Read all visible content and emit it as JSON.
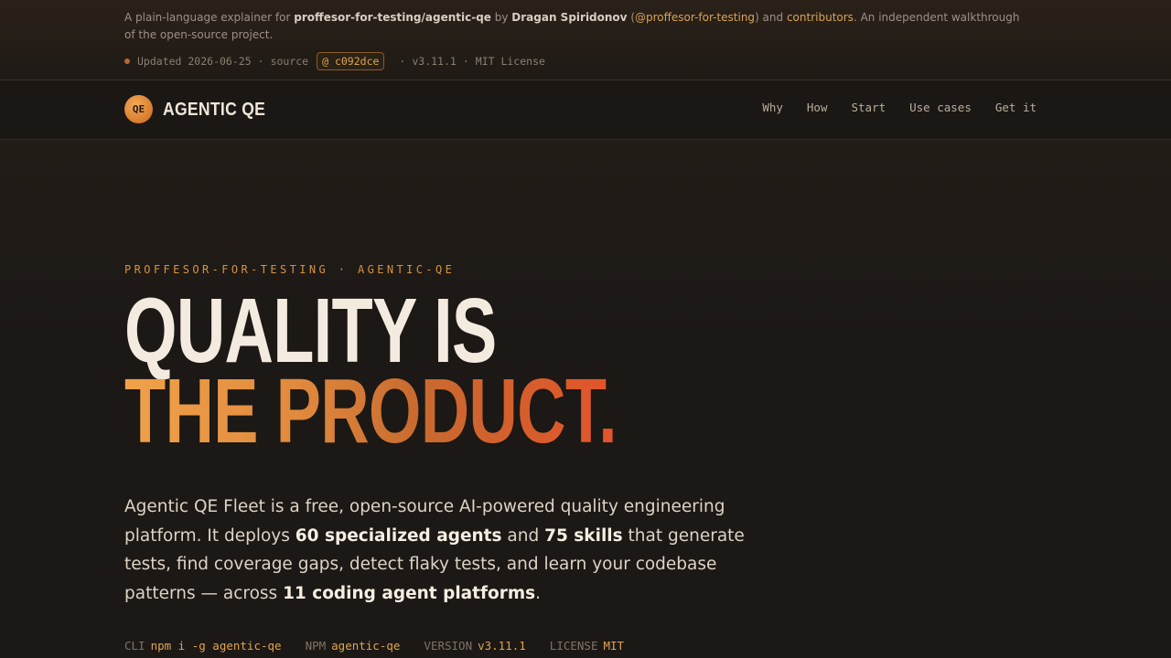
{
  "intro": {
    "prefix": "A plain-language explainer for ",
    "repo": "proffesor-for-testing/agentic-qe",
    "by": " by ",
    "author": "Dragan Spiridonov",
    "paren_open": " (",
    "handle": "@proffesor-for-testing",
    "paren_close": ") and ",
    "contributors": "contributors",
    "suffix": ". An independent walkthrough of the open-source project."
  },
  "meta": {
    "updated": "Updated 2026-06-25",
    "sep1": "·",
    "source_label": "source",
    "sha": "@ c092dce",
    "sep2": "·",
    "version": "v3.11.1",
    "sep3": "·",
    "license": "MIT License"
  },
  "nav": {
    "logo_text": "QE",
    "brand": "AGENTIC QE",
    "links": [
      "Why",
      "How",
      "Start",
      "Use cases",
      "Get it"
    ]
  },
  "hero": {
    "eyebrow": "PROFFESOR-FOR-TESTING · AGENTIC-QE",
    "title_line1": "QUALITY IS",
    "title_line2": "THE PRODUCT.",
    "lead": {
      "t1": "Agentic QE Fleet is a free, open-source AI-powered quality engineering platform. It deploys ",
      "b1": "60 specialized agents",
      "t2": " and ",
      "b2": "75 skills",
      "t3": " that generate tests, find coverage gaps, detect flaky tests, and learn your codebase patterns — across ",
      "b3": "11 coding agent platforms",
      "t4": "."
    },
    "facts": [
      {
        "key": "CLI",
        "value": "npm i -g agentic-qe"
      },
      {
        "key": "NPM",
        "value": "agentic-qe"
      },
      {
        "key": "VERSION",
        "value": "v3.11.1"
      },
      {
        "key": "LICENSE",
        "value": "MIT"
      }
    ]
  },
  "colors": {
    "accent": "#e0a54d",
    "background": "#1c1815",
    "gradient_start": "#f0a24a",
    "gradient_end": "#e2542a"
  }
}
